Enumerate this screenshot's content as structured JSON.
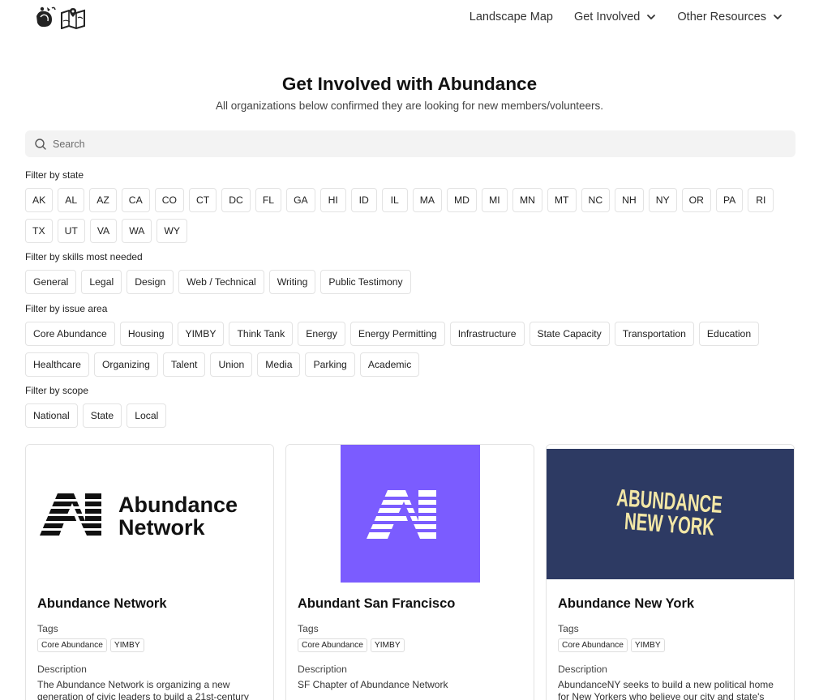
{
  "header": {
    "nav": [
      {
        "label": "Landscape Map",
        "dropdown": false
      },
      {
        "label": "Get Involved",
        "dropdown": true
      },
      {
        "label": "Other Resources",
        "dropdown": true
      }
    ]
  },
  "hero": {
    "title": "Get Involved with Abundance",
    "subtitle": "All organizations below confirmed they are looking for new members/volunteers."
  },
  "search": {
    "placeholder": "Search",
    "value": ""
  },
  "filters": {
    "state": {
      "label": "Filter by state",
      "options": [
        "AK",
        "AL",
        "AZ",
        "CA",
        "CO",
        "CT",
        "DC",
        "FL",
        "GA",
        "HI",
        "ID",
        "IL",
        "MA",
        "MD",
        "MI",
        "MN",
        "MT",
        "NC",
        "NH",
        "NY",
        "OR",
        "PA",
        "RI",
        "TX",
        "UT",
        "VA",
        "WA",
        "WY"
      ]
    },
    "skills": {
      "label": "Filter by skills most needed",
      "options": [
        "General",
        "Legal",
        "Design",
        "Web / Technical",
        "Writing",
        "Public Testimony"
      ]
    },
    "issue": {
      "label": "Filter by issue area",
      "options": [
        "Core Abundance",
        "Housing",
        "YIMBY",
        "Think Tank",
        "Energy",
        "Energy Permitting",
        "Infrastructure",
        "State Capacity",
        "Transportation",
        "Education",
        "Healthcare",
        "Organizing",
        "Talent",
        "Union",
        "Media",
        "Parking",
        "Academic"
      ]
    },
    "scope": {
      "label": "Filter by scope",
      "options": [
        "National",
        "State",
        "Local"
      ]
    }
  },
  "cards": [
    {
      "name": "Abundance Network",
      "logo_text": [
        "Abundance",
        "Network"
      ],
      "image_bg": "#ffffff",
      "tags_label": "Tags",
      "tags": [
        "Core Abundance",
        "YIMBY"
      ],
      "desc_label": "Description",
      "description": "The Abundance Network is organizing a new generation of civic leaders to build a 21st-century"
    },
    {
      "name": "Abundant San Francisco",
      "image_bg": "#7b5cff",
      "tags_label": "Tags",
      "tags": [
        "Core Abundance",
        "YIMBY"
      ],
      "desc_label": "Description",
      "description": "SF Chapter of Abundance Network"
    },
    {
      "name": "Abundance New York",
      "logo_text": [
        "ABUNDANCE",
        "NEW YORK"
      ],
      "image_bg": "#2d3a63",
      "tags_label": "Tags",
      "tags": [
        "Core Abundance",
        "YIMBY"
      ],
      "desc_label": "Description",
      "description": "AbundanceNY seeks to build a new political home for New Yorkers who believe our city and state's"
    }
  ],
  "colors": {
    "accent_purple": "#7b5cff",
    "navy": "#2d3a63",
    "logo_cream": "#f3e7a6"
  }
}
